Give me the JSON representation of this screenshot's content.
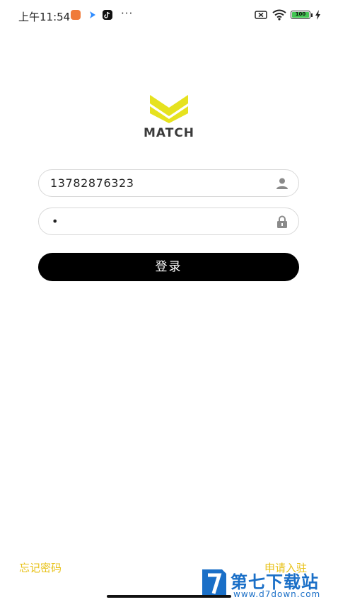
{
  "status_bar": {
    "time": "上午11:54",
    "more": "···",
    "battery_level": "100"
  },
  "logo": {
    "brand_text": "MATCH",
    "brand_color": "#e6e21f"
  },
  "login_form": {
    "phone_value": "13782876323",
    "password_masked": "•",
    "login_label": "登录"
  },
  "links": {
    "forgot_password": "忘记密码",
    "apply_join": "申请入驻"
  },
  "watermark": {
    "title": "第七下载站",
    "url": "www.d7down.com"
  },
  "colors": {
    "accent": "#e8c21a",
    "button_bg": "#000000",
    "watermark": "#1a6fc7"
  }
}
